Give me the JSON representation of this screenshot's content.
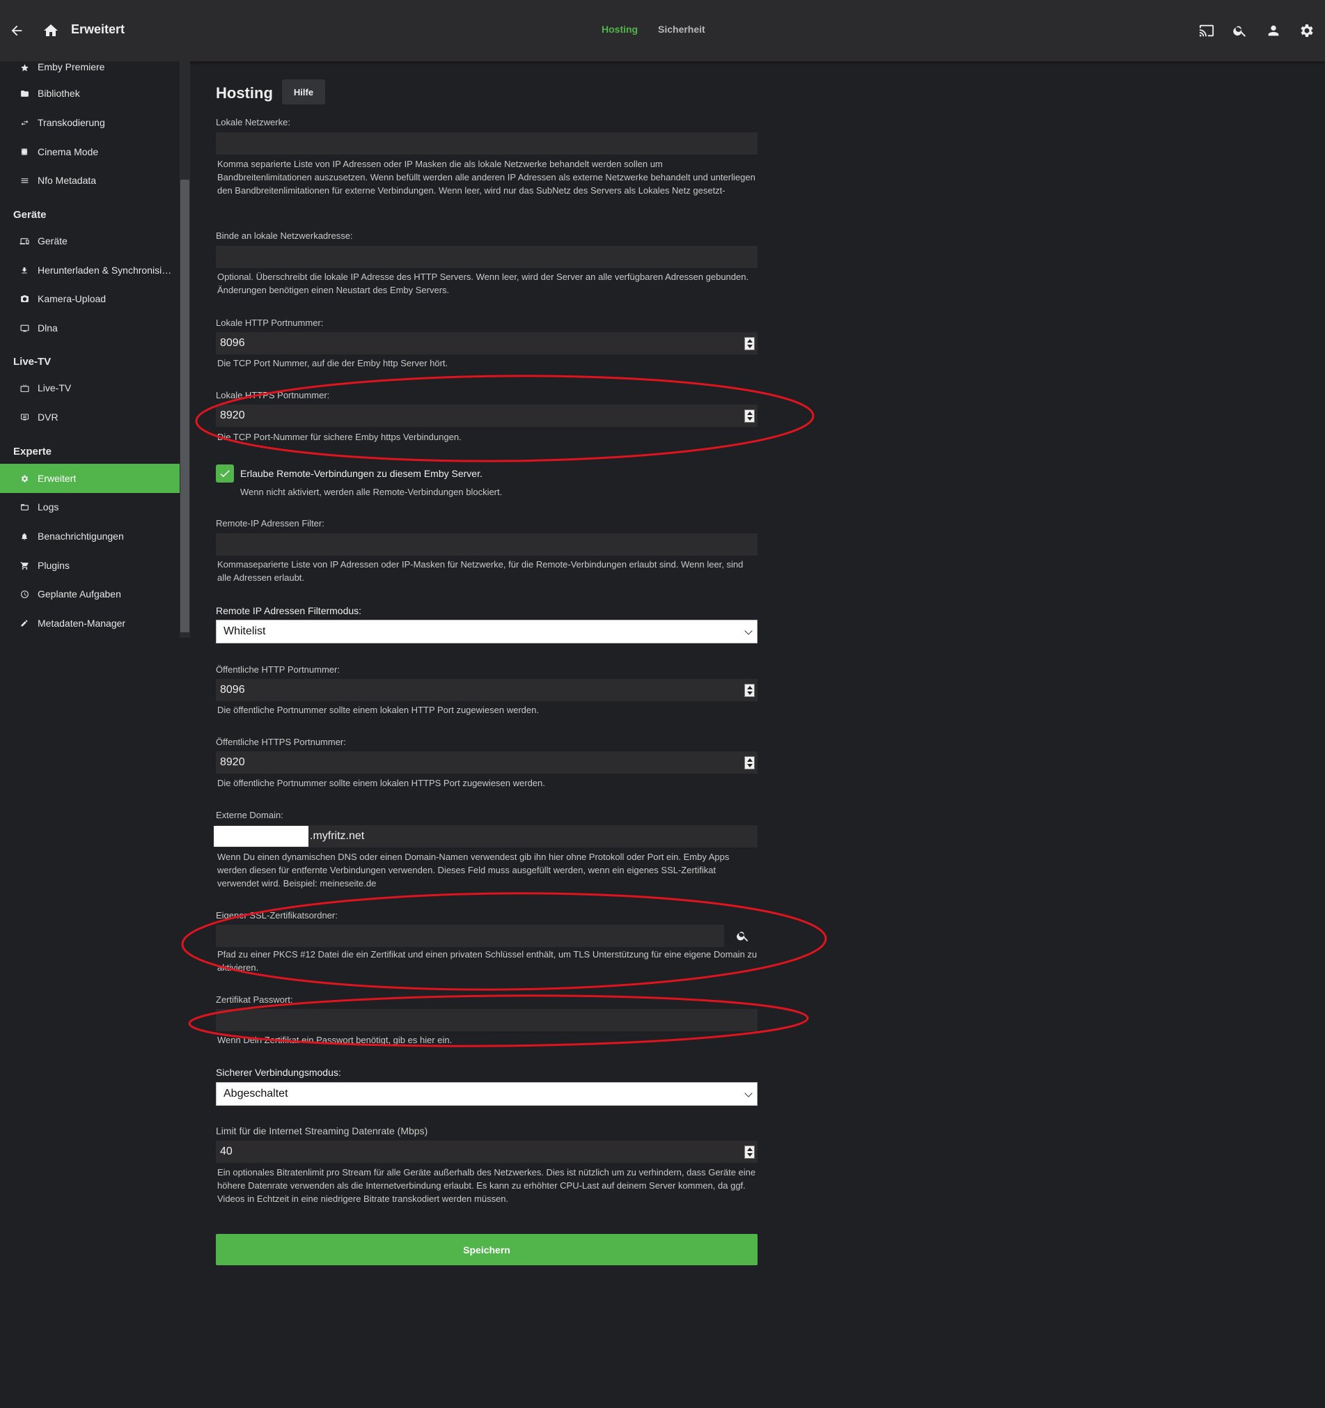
{
  "header": {
    "title": "Erweitert",
    "tabs": [
      {
        "label": "Hosting",
        "active": true
      },
      {
        "label": "Sicherheit",
        "active": false
      }
    ],
    "icons": [
      "back-arrow-icon",
      "home-icon",
      "cast-icon",
      "search-icon",
      "user-icon",
      "gear-icon"
    ]
  },
  "sidebar": {
    "items_top": [
      {
        "label": "Emby Premiere",
        "icon": "star-icon"
      },
      {
        "label": "Bibliothek",
        "icon": "folder-icon"
      },
      {
        "label": "Transkodierung",
        "icon": "transcode-icon"
      },
      {
        "label": "Cinema Mode",
        "icon": "film-icon"
      },
      {
        "label": "Nfo Metadata",
        "icon": "list-icon"
      }
    ],
    "section_devices": "Geräte",
    "items_devices": [
      {
        "label": "Geräte",
        "icon": "devices-icon"
      },
      {
        "label": "Herunterladen & Synchronisieren",
        "icon": "download-icon"
      },
      {
        "label": "Kamera-Upload",
        "icon": "camera-icon"
      },
      {
        "label": "Dlna",
        "icon": "dlna-icon"
      }
    ],
    "section_livetv": "Live-TV",
    "items_livetv": [
      {
        "label": "Live-TV",
        "icon": "tv-icon"
      },
      {
        "label": "DVR",
        "icon": "dvr-icon"
      }
    ],
    "section_expert": "Experte",
    "items_expert": [
      {
        "label": "Erweitert",
        "icon": "gear-icon",
        "active": true
      },
      {
        "label": "Logs",
        "icon": "folder-icon"
      },
      {
        "label": "Benachrichtigungen",
        "icon": "bell-icon"
      },
      {
        "label": "Plugins",
        "icon": "cart-icon"
      },
      {
        "label": "Geplante Aufgaben",
        "icon": "clock-icon"
      },
      {
        "label": "Metadaten-Manager",
        "icon": "pencil-icon"
      }
    ]
  },
  "form": {
    "page_title": "Hosting",
    "help_label": "Hilfe",
    "local_networks": {
      "label": "Lokale Netzwerke:",
      "value": "",
      "description": "Komma separierte Liste von IP Adressen oder IP Masken die als lokale Netzwerke behandelt werden sollen um Bandbreitenlimitationen auszusetzen. Wenn befüllt werden alle anderen IP Adressen als externe Netzwerke behandelt und unterliegen den Bandbreitenlimitationen für externe Verbindungen. Wenn leer, wird nur das SubNetz des Servers als Lokales Netz gesetzt-"
    },
    "bind_address": {
      "label": "Binde an lokale Netzwerkadresse:",
      "value": "",
      "description": "Optional. Überschreibt die lokale IP Adresse des HTTP Servers. Wenn leer, wird der Server an alle verfügbaren Adressen gebunden. Änderungen benötigen einen Neustart des Emby Servers."
    },
    "local_http_port": {
      "label": "Lokale HTTP Portnummer:",
      "value": "8096",
      "description": "Die TCP Port Nummer, auf die der Emby http Server hört."
    },
    "local_https_port": {
      "label": "Lokale HTTPS Portnummer:",
      "value": "8920",
      "description": "Die TCP Port-Nummer für sichere Emby https Verbindungen."
    },
    "allow_remote": {
      "label": "Erlaube Remote-Verbindungen zu diesem Emby Server.",
      "checked": true,
      "description": "Wenn nicht aktiviert, werden alle Remote-Verbindungen blockiert."
    },
    "remote_ip_filter": {
      "label": "Remote-IP Adressen Filter:",
      "value": "",
      "description": "Kommaseparierte Liste von IP Adressen oder IP-Masken für Netzwerke, für die Remote-Verbindungen erlaubt sind. Wenn leer, sind alle Adressen erlaubt."
    },
    "remote_filter_mode": {
      "label": "Remote IP Adressen Filtermodus:",
      "value": "Whitelist"
    },
    "public_http_port": {
      "label": "Öffentliche HTTP Portnummer:",
      "value": "8096",
      "description": "Die öffentliche Portnummer sollte einem lokalen HTTP Port zugewiesen werden."
    },
    "public_https_port": {
      "label": "Öffentliche HTTPS Portnummer:",
      "value": "8920",
      "description": "Die öffentliche Portnummer sollte einem lokalen HTTPS Port zugewiesen werden."
    },
    "external_domain": {
      "label": "Externe Domain:",
      "value": ".myfritz.net",
      "description": "Wenn Du einen dynamischen DNS oder einen Domain-Namen verwendest gib ihn hier ohne Protokoll oder Port ein. Emby Apps werden diesen für entfernte Verbindungen verwenden. Dieses Feld muss ausgefüllt werden, wenn ein eigenes SSL-Zertifikat verwendet wird. Beispiel: meineseite.de"
    },
    "ssl_cert_path": {
      "label": "Eigener SSL-Zertifikatsordner:",
      "value": "",
      "description": "Pfad zu einer PKCS #12 Datei die ein Zertifikat und einen privaten Schlüssel enthält, um TLS Unterstützung für eine eigene Domain zu aktivieren."
    },
    "cert_password": {
      "label": "Zertifikat Passwort:",
      "value": "",
      "description": "Wenn Dein Zertifikat ein Passwort benötigt, gib es hier ein."
    },
    "secure_mode": {
      "label": "Sicherer Verbindungsmodus:",
      "value": "Abgeschaltet"
    },
    "streaming_limit": {
      "label": "Limit für die Internet Streaming Datenrate (Mbps)",
      "value": "40",
      "description": "Ein optionales Bitratenlimit pro Stream für alle Geräte außerhalb des Netzwerkes. Dies ist nützlich um zu verhindern, dass Geräte eine höhere Datenrate verwenden als die Internetverbindung erlaubt. Es kann zu erhöhter CPU-Last auf deinem Server kommen, da ggf. Videos in Echtzeit in eine niedrigere Bitrate transkodiert werden müssen."
    },
    "save_label": "Speichern"
  },
  "colors": {
    "accent": "#52b54b",
    "background": "#1f2023",
    "header": "#2b2b2e",
    "input": "#2c2c2f",
    "annotation": "#e0141e"
  }
}
